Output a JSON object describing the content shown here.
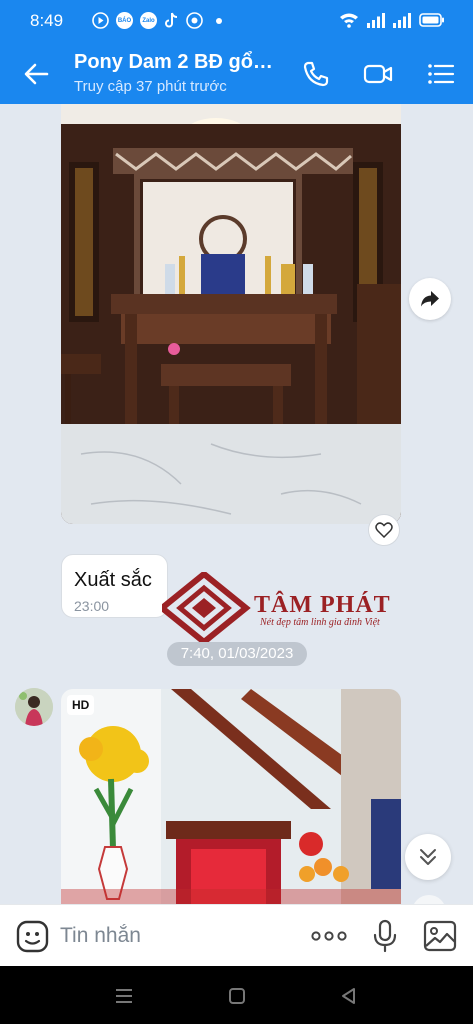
{
  "status_bar": {
    "time": "8:49",
    "app_icons": [
      "BÁO MỚI",
      "Zalo",
      "TikTok",
      "Chrome"
    ],
    "icons": [
      "wifi-icon",
      "signal-icon",
      "signal-icon",
      "battery-icon"
    ]
  },
  "header": {
    "title": "Pony Dam 2 BĐ gổ…",
    "subtitle": "Truy cập 37 phút trước",
    "bg_color": "#1a87ef"
  },
  "messages": [
    {
      "type": "image",
      "description_icon": "altar-photo"
    },
    {
      "type": "text",
      "text": "Xuất sắc",
      "time": "23:00"
    }
  ],
  "date_separator": "7:40, 01/03/2023",
  "watermark": {
    "name": "TÂM PHÁT",
    "slogan": "Nét đẹp tâm linh gia đình Việt",
    "color": "#9b2124"
  },
  "incoming_image": {
    "badge": "HD"
  },
  "composer": {
    "placeholder": "Tin nhắn"
  }
}
